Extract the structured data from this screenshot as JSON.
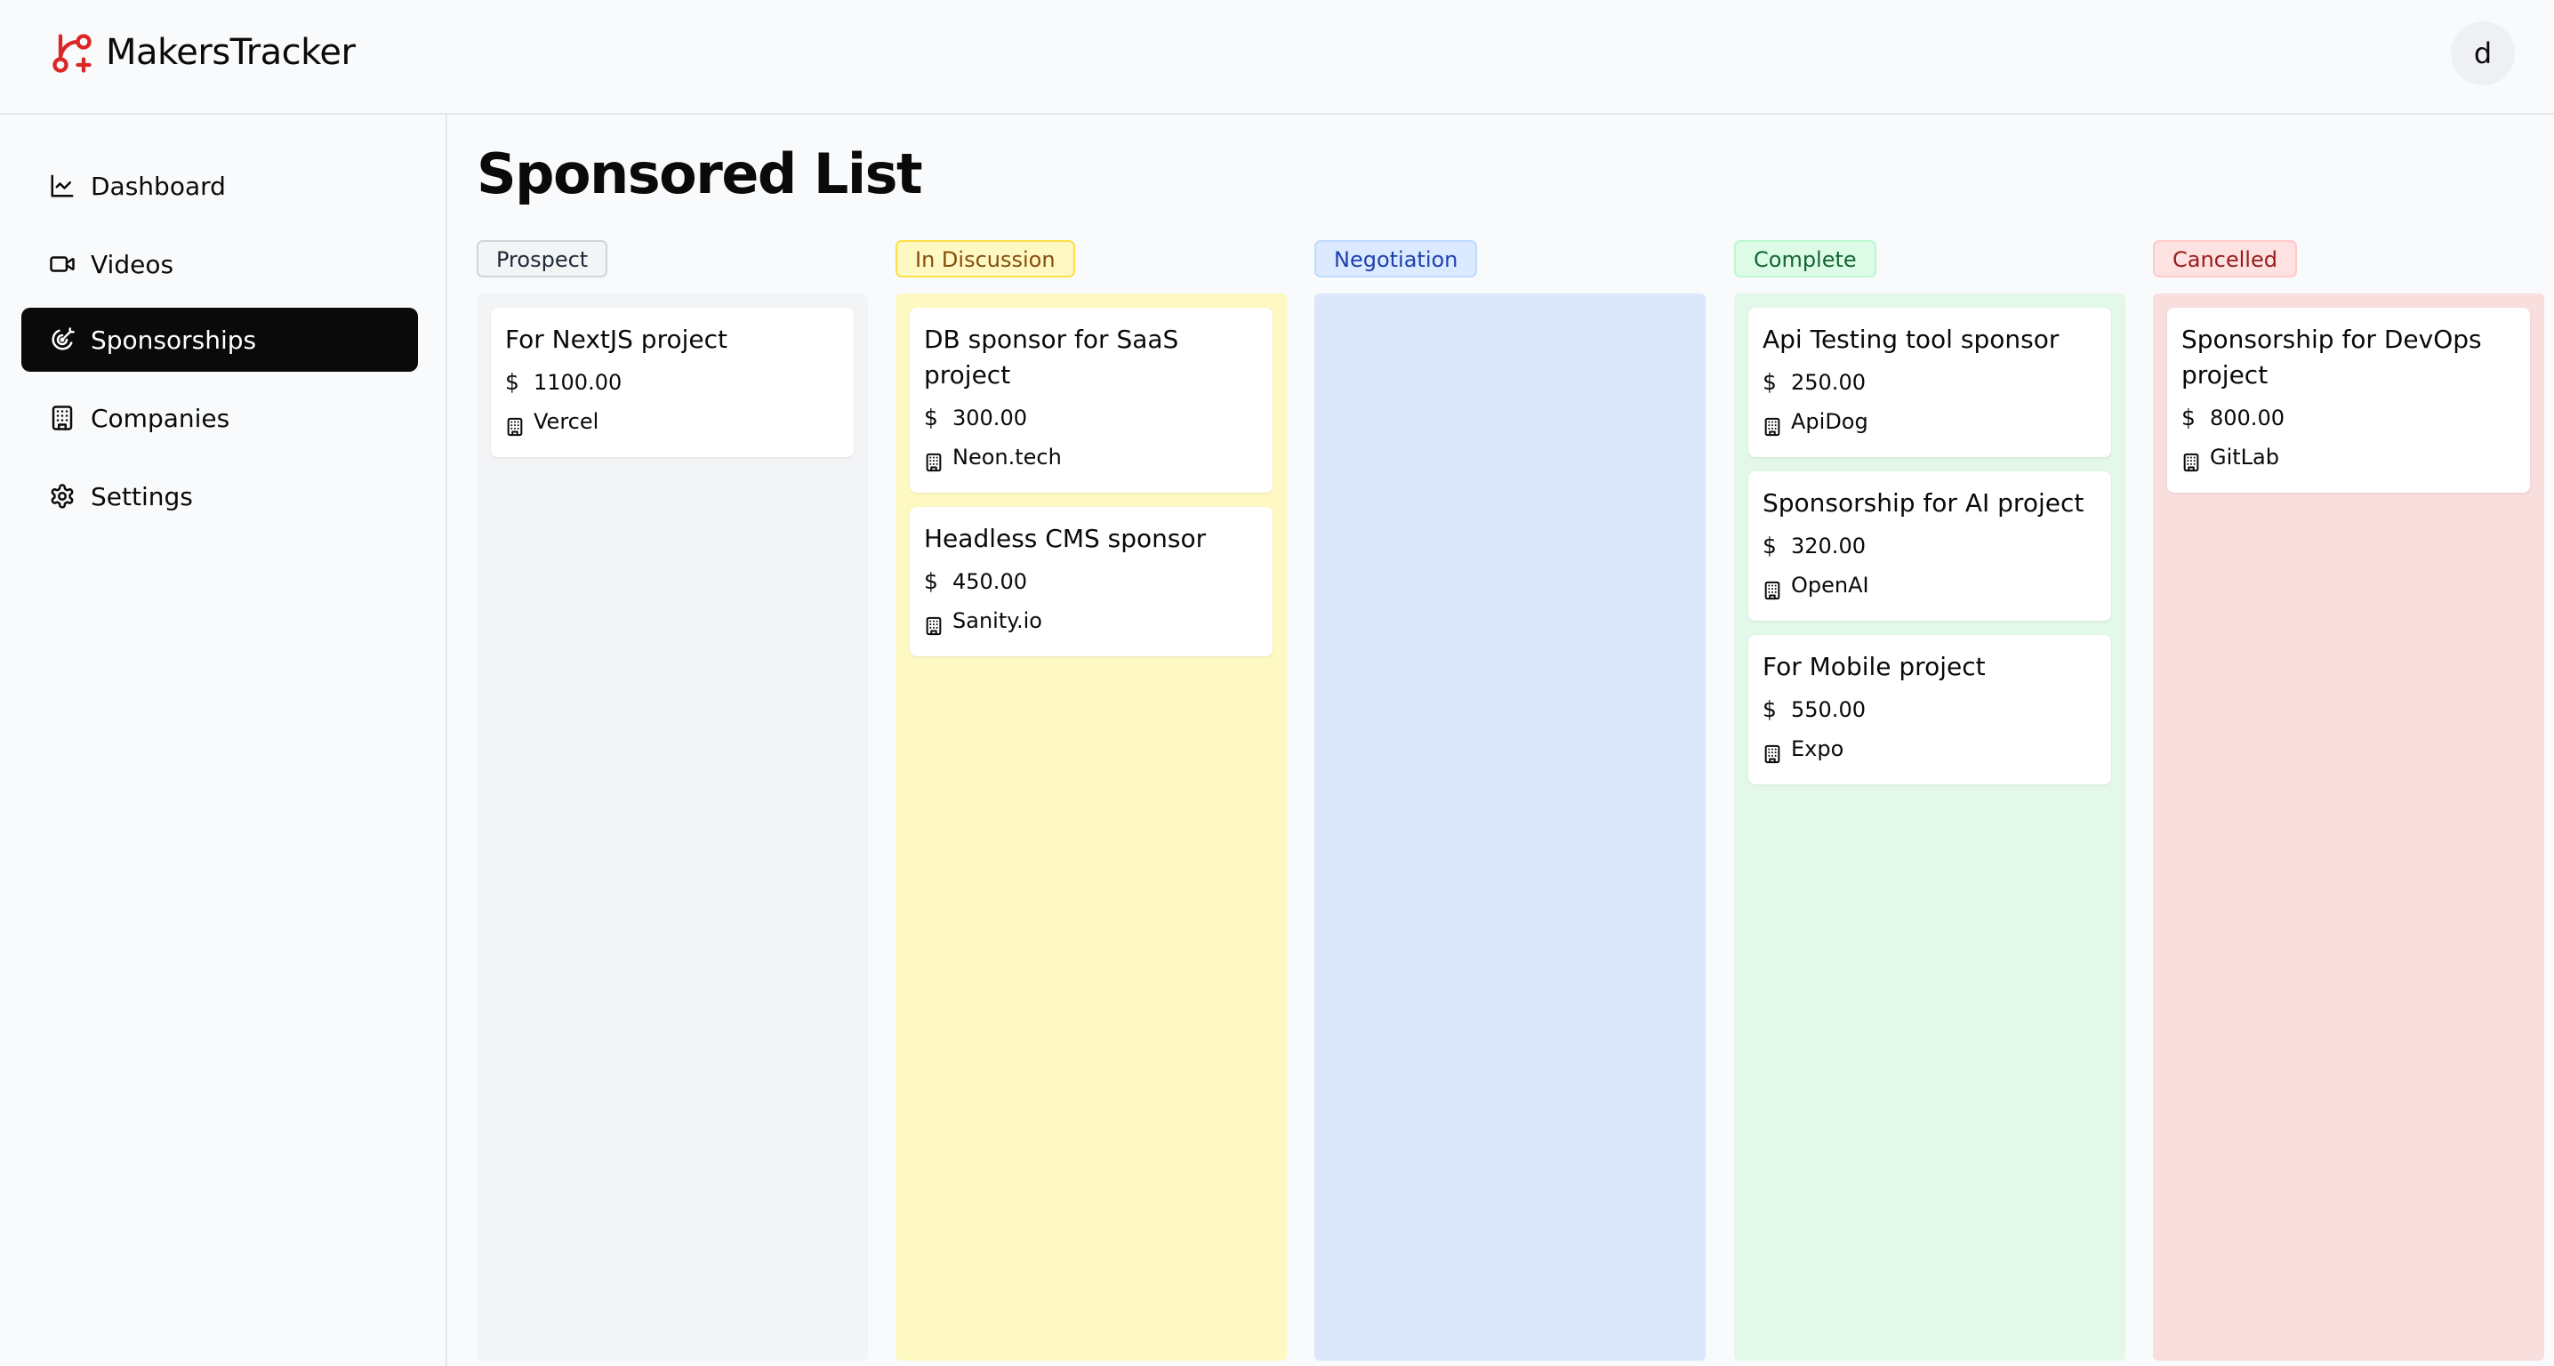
{
  "app": {
    "title": "MakersTracker",
    "user_initial": "d",
    "accent": "#dc2626"
  },
  "sidebar": {
    "items": [
      {
        "label": "Dashboard",
        "icon": "chart-line-icon",
        "active": false
      },
      {
        "label": "Videos",
        "icon": "video-icon",
        "active": false
      },
      {
        "label": "Sponsorships",
        "icon": "target-icon",
        "active": true
      },
      {
        "label": "Companies",
        "icon": "building-icon",
        "active": false
      },
      {
        "label": "Settings",
        "icon": "gear-icon",
        "active": false
      }
    ]
  },
  "page": {
    "title": "Sponsored List"
  },
  "board": {
    "columns": [
      {
        "status": "Prospect",
        "lane_color": "#f3f4f6",
        "badge_bg": "#f3f4f6",
        "badge_border": "#d1d5db",
        "badge_text": "#1f2937",
        "cards": [
          {
            "title": "For NextJS project",
            "amount": "1100.00",
            "company": "Vercel"
          }
        ]
      },
      {
        "status": "In Discussion",
        "lane_color": "#fef9c3",
        "badge_bg": "#fef9c3",
        "badge_border": "#fde047",
        "badge_text": "#854d0e",
        "cards": [
          {
            "title": "DB sponsor for SaaS project",
            "amount": "300.00",
            "company": "Neon.tech"
          },
          {
            "title": "Headless CMS sponsor",
            "amount": "450.00",
            "company": "Sanity.io"
          }
        ]
      },
      {
        "status": "Negotiation",
        "lane_color": "#dbe7fb",
        "badge_bg": "#dbeafe",
        "badge_border": "#bfdbfe",
        "badge_text": "#1e40af",
        "cards": []
      },
      {
        "status": "Complete",
        "lane_color": "#e3f8e8",
        "badge_bg": "#dcfce7",
        "badge_border": "#bbf7d0",
        "badge_text": "#166534",
        "cards": [
          {
            "title": "Api Testing tool sponsor",
            "amount": "250.00",
            "company": "ApiDog"
          },
          {
            "title": "Sponsorship for AI project",
            "amount": "320.00",
            "company": "OpenAI"
          },
          {
            "title": "For Mobile project",
            "amount": "550.00",
            "company": "Expo"
          }
        ]
      },
      {
        "status": "Cancelled",
        "lane_color": "#f9dede",
        "badge_bg": "#fee2e2",
        "badge_border": "#fecaca",
        "badge_text": "#991b1b",
        "cards": [
          {
            "title": "Sponsorship for DevOps project",
            "amount": "800.00",
            "company": "GitLab"
          }
        ]
      }
    ]
  }
}
